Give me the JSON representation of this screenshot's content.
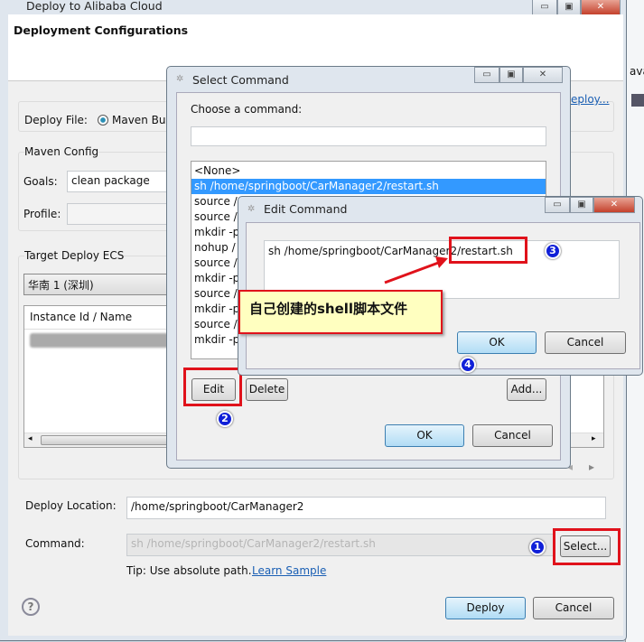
{
  "main_window": {
    "title": "Deploy to Alibaba Cloud",
    "header": "Deployment Configurations",
    "deploy_file_label": "Deploy File:",
    "deploy_file_option": "Maven Bu",
    "link_partial": "eploy...",
    "maven_config_title": "Maven Config",
    "goals_label": "Goals:",
    "goals_value": "clean package",
    "profile_label": "Profile:",
    "profile_value": "",
    "target_ecs_title": "Target Deploy ECS",
    "region_value": "华南 1 (深圳)",
    "table_header": "Instance Id / Name",
    "deploy_location_label": "Deploy Location:",
    "deploy_location_value": "/home/springboot/CarManager2",
    "command_label": "Command:",
    "command_value": "sh /home/springboot/CarManager2/restart.sh",
    "select_button": "Select...",
    "tip_text": "Tip: Use absolute path.",
    "tip_link": "Learn Sample",
    "deploy_button": "Deploy",
    "cancel_button": "Cancel"
  },
  "background_app": {
    "text": "ava"
  },
  "select_dialog": {
    "title": "Select Command",
    "prompt": "Choose a command:",
    "filter_value": "",
    "items": [
      "<None>",
      "sh /home/springboot/CarManager2/restart.sh",
      "source /",
      "source /",
      "mkdir -p",
      "nohup /",
      "source /",
      "mkdir -p",
      "source /",
      "mkdir -p",
      "source /",
      "mkdir -p"
    ],
    "selected_index": 1,
    "edit_button": "Edit",
    "delete_button": "Delete",
    "add_button": "Add...",
    "ok_button": "OK",
    "cancel_button": "Cancel"
  },
  "edit_dialog": {
    "title": "Edit Command",
    "command_value": "sh /home/springboot/CarManager2/restart.sh",
    "ok_button": "OK",
    "cancel_button": "Cancel"
  },
  "annotations": {
    "callout": "自己创建的shell脚本文件",
    "badges": [
      "1",
      "2",
      "3",
      "4"
    ],
    "highlight_color": "#e0121b",
    "badge_color": "#1020d8",
    "callout_bg": "#ffffc0"
  }
}
